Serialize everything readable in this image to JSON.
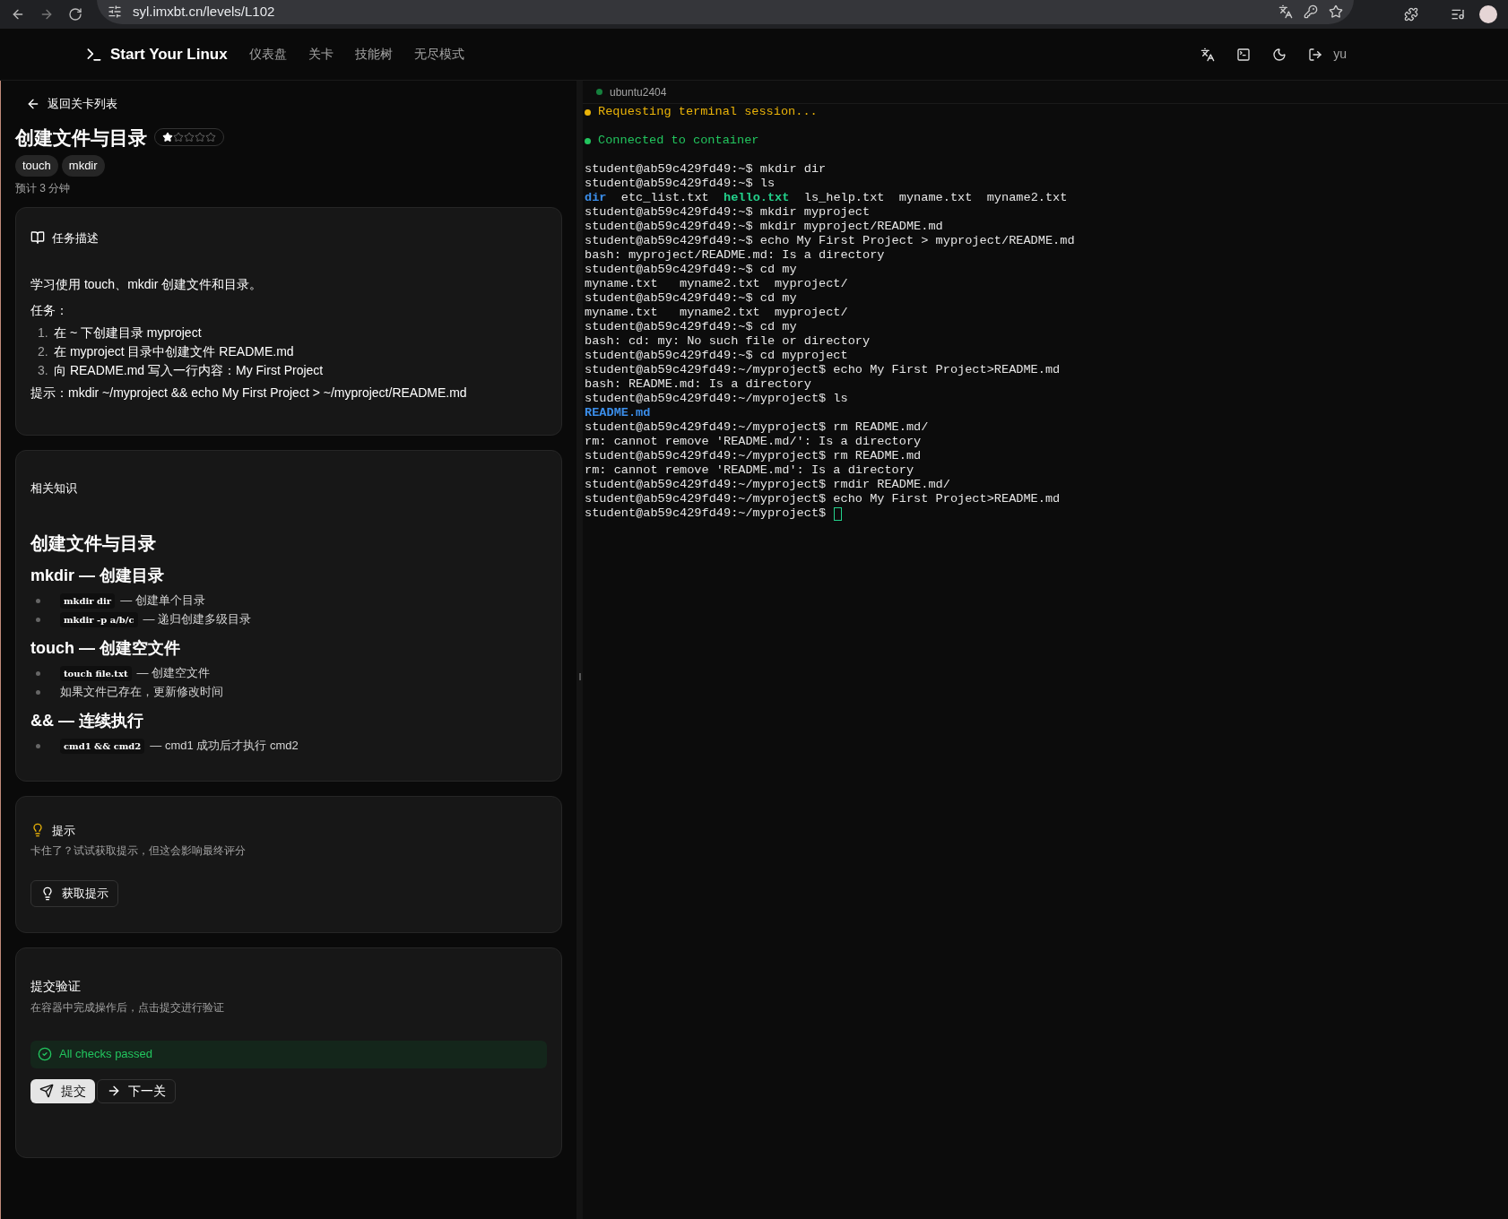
{
  "browser": {
    "url": "syl.imxbt.cn/levels/L102"
  },
  "header": {
    "brand": "Start Your Linux",
    "nav": [
      {
        "label": "仪表盘",
        "selected": false
      },
      {
        "label": "关卡",
        "selected": false
      },
      {
        "label": "技能树",
        "selected": false
      },
      {
        "label": "无尽模式",
        "selected": false
      }
    ],
    "user": "yu"
  },
  "level": {
    "back": "返回关卡列表",
    "title": "创建文件与目录",
    "stars": 1,
    "tags": [
      "touch",
      "mkdir"
    ],
    "estimate": "预计 3 分钟"
  },
  "task": {
    "heading": "任务描述",
    "intro": "学习使用 touch、mkdir 创建文件和目录。",
    "label": "任务：",
    "steps": [
      {
        "num": "1.",
        "text": "在 ~ 下创建目录 myproject"
      },
      {
        "num": "2.",
        "text": "在 myproject 目录中创建文件 README.md"
      },
      {
        "num": "3.",
        "text": "向 README.md 写入一行内容：My First Project"
      }
    ],
    "hint": "提示：mkdir ~/myproject && echo My First Project > ~/myproject/README.md"
  },
  "knowledge": {
    "heading": "相关知识",
    "title": "创建文件与目录",
    "sections": [
      {
        "heading": "mkdir — 创建目录",
        "items": [
          {
            "code": "mkdir dir",
            "text": "— 创建单个目录"
          },
          {
            "code": "mkdir -p a/b/c",
            "text": "— 递归创建多级目录"
          }
        ]
      },
      {
        "heading": "touch — 创建空文件",
        "items": [
          {
            "code": "touch file.txt",
            "text": "— 创建空文件"
          },
          {
            "text": "如果文件已存在，更新修改时间"
          }
        ]
      },
      {
        "heading": "&& — 连续执行",
        "items": [
          {
            "code": "cmd1 && cmd2",
            "text": "— cmd1 成功后才执行 cmd2"
          }
        ]
      }
    ]
  },
  "hints": {
    "heading": "提示",
    "note": "卡住了？试试获取提示，但这会影响最终评分",
    "button": "获取提示"
  },
  "submit": {
    "heading": "提交验证",
    "note": "在容器中完成操作后，点击提交进行验证",
    "result": {
      "passed": true,
      "text": "All checks passed"
    },
    "buttons": [
      {
        "label": "提交",
        "kind": "primary"
      },
      {
        "label": "下一关",
        "kind": "secondary"
      }
    ]
  },
  "terminal": {
    "host": "ubuntu2404",
    "lines": [
      {
        "kind": "status",
        "color": "#eab308",
        "text": "Requesting terminal session..."
      },
      {
        "kind": "blank"
      },
      {
        "kind": "status",
        "color": "#22c55e",
        "text": "Connected to container"
      },
      {
        "kind": "blank"
      },
      {
        "kind": "plain",
        "segments": [
          {
            "text": "student@ab59c429fd49:~$ mkdir dir",
            "kind": "plain"
          }
        ]
      },
      {
        "kind": "plain",
        "segments": [
          {
            "text": "student@ab59c429fd49:~$ ls",
            "kind": "plain"
          }
        ]
      },
      {
        "kind": "plain",
        "segments": [
          {
            "text": "dir",
            "kind": "dir"
          },
          {
            "text": "  etc_list.txt  ",
            "kind": "plain"
          },
          {
            "text": "hello.txt",
            "kind": "exec"
          },
          {
            "text": "  ls_help.txt  myname.txt  myname2.txt",
            "kind": "plain"
          }
        ]
      },
      {
        "kind": "plain",
        "segments": [
          {
            "text": "student@ab59c429fd49:~$ mkdir myproject",
            "kind": "plain"
          }
        ]
      },
      {
        "kind": "plain",
        "segments": [
          {
            "text": "student@ab59c429fd49:~$ mkdir myproject/README.md",
            "kind": "plain"
          }
        ]
      },
      {
        "kind": "plain",
        "segments": [
          {
            "text": "student@ab59c429fd49:~$ echo My First Project > myproject/README.md",
            "kind": "plain"
          }
        ]
      },
      {
        "kind": "plain",
        "segments": [
          {
            "text": "bash: myproject/README.md: Is a directory",
            "kind": "plain"
          }
        ]
      },
      {
        "kind": "plain",
        "segments": [
          {
            "text": "student@ab59c429fd49:~$ cd my",
            "kind": "plain"
          }
        ]
      },
      {
        "kind": "plain",
        "segments": [
          {
            "text": "myname.txt   myname2.txt  myproject/",
            "kind": "plain"
          }
        ]
      },
      {
        "kind": "plain",
        "segments": [
          {
            "text": "student@ab59c429fd49:~$ cd my",
            "kind": "plain"
          }
        ]
      },
      {
        "kind": "plain",
        "segments": [
          {
            "text": "myname.txt   myname2.txt  myproject/",
            "kind": "plain"
          }
        ]
      },
      {
        "kind": "plain",
        "segments": [
          {
            "text": "student@ab59c429fd49:~$ cd my",
            "kind": "plain"
          }
        ]
      },
      {
        "kind": "plain",
        "segments": [
          {
            "text": "bash: cd: my: No such file or directory",
            "kind": "plain"
          }
        ]
      },
      {
        "kind": "plain",
        "segments": [
          {
            "text": "student@ab59c429fd49:~$ cd myproject",
            "kind": "plain"
          }
        ]
      },
      {
        "kind": "plain",
        "segments": [
          {
            "text": "student@ab59c429fd49:~/myproject$ echo My First Project>README.md",
            "kind": "plain"
          }
        ]
      },
      {
        "kind": "plain",
        "segments": [
          {
            "text": "bash: README.md: Is a directory",
            "kind": "plain"
          }
        ]
      },
      {
        "kind": "plain",
        "segments": [
          {
            "text": "student@ab59c429fd49:~/myproject$ ls",
            "kind": "plain"
          }
        ]
      },
      {
        "kind": "plain",
        "segments": [
          {
            "text": "README.md",
            "kind": "dir"
          }
        ]
      },
      {
        "kind": "plain",
        "segments": [
          {
            "text": "student@ab59c429fd49:~/myproject$ rm README.md/",
            "kind": "plain"
          }
        ]
      },
      {
        "kind": "plain",
        "segments": [
          {
            "text": "rm: cannot remove 'README.md/': Is a directory",
            "kind": "plain"
          }
        ]
      },
      {
        "kind": "plain",
        "segments": [
          {
            "text": "student@ab59c429fd49:~/myproject$ rm README.md",
            "kind": "plain"
          }
        ]
      },
      {
        "kind": "plain",
        "segments": [
          {
            "text": "rm: cannot remove 'README.md': Is a directory",
            "kind": "plain"
          }
        ]
      },
      {
        "kind": "plain",
        "segments": [
          {
            "text": "student@ab59c429fd49:~/myproject$ rmdir README.md/",
            "kind": "plain"
          }
        ]
      },
      {
        "kind": "plain",
        "segments": [
          {
            "text": "student@ab59c429fd49:~/myproject$ echo My First Project>README.md",
            "kind": "plain"
          }
        ]
      },
      {
        "kind": "plain",
        "cursor": true,
        "segments": [
          {
            "text": "student@ab59c429fd49:~/myproject$",
            "kind": "plain"
          }
        ]
      }
    ]
  }
}
